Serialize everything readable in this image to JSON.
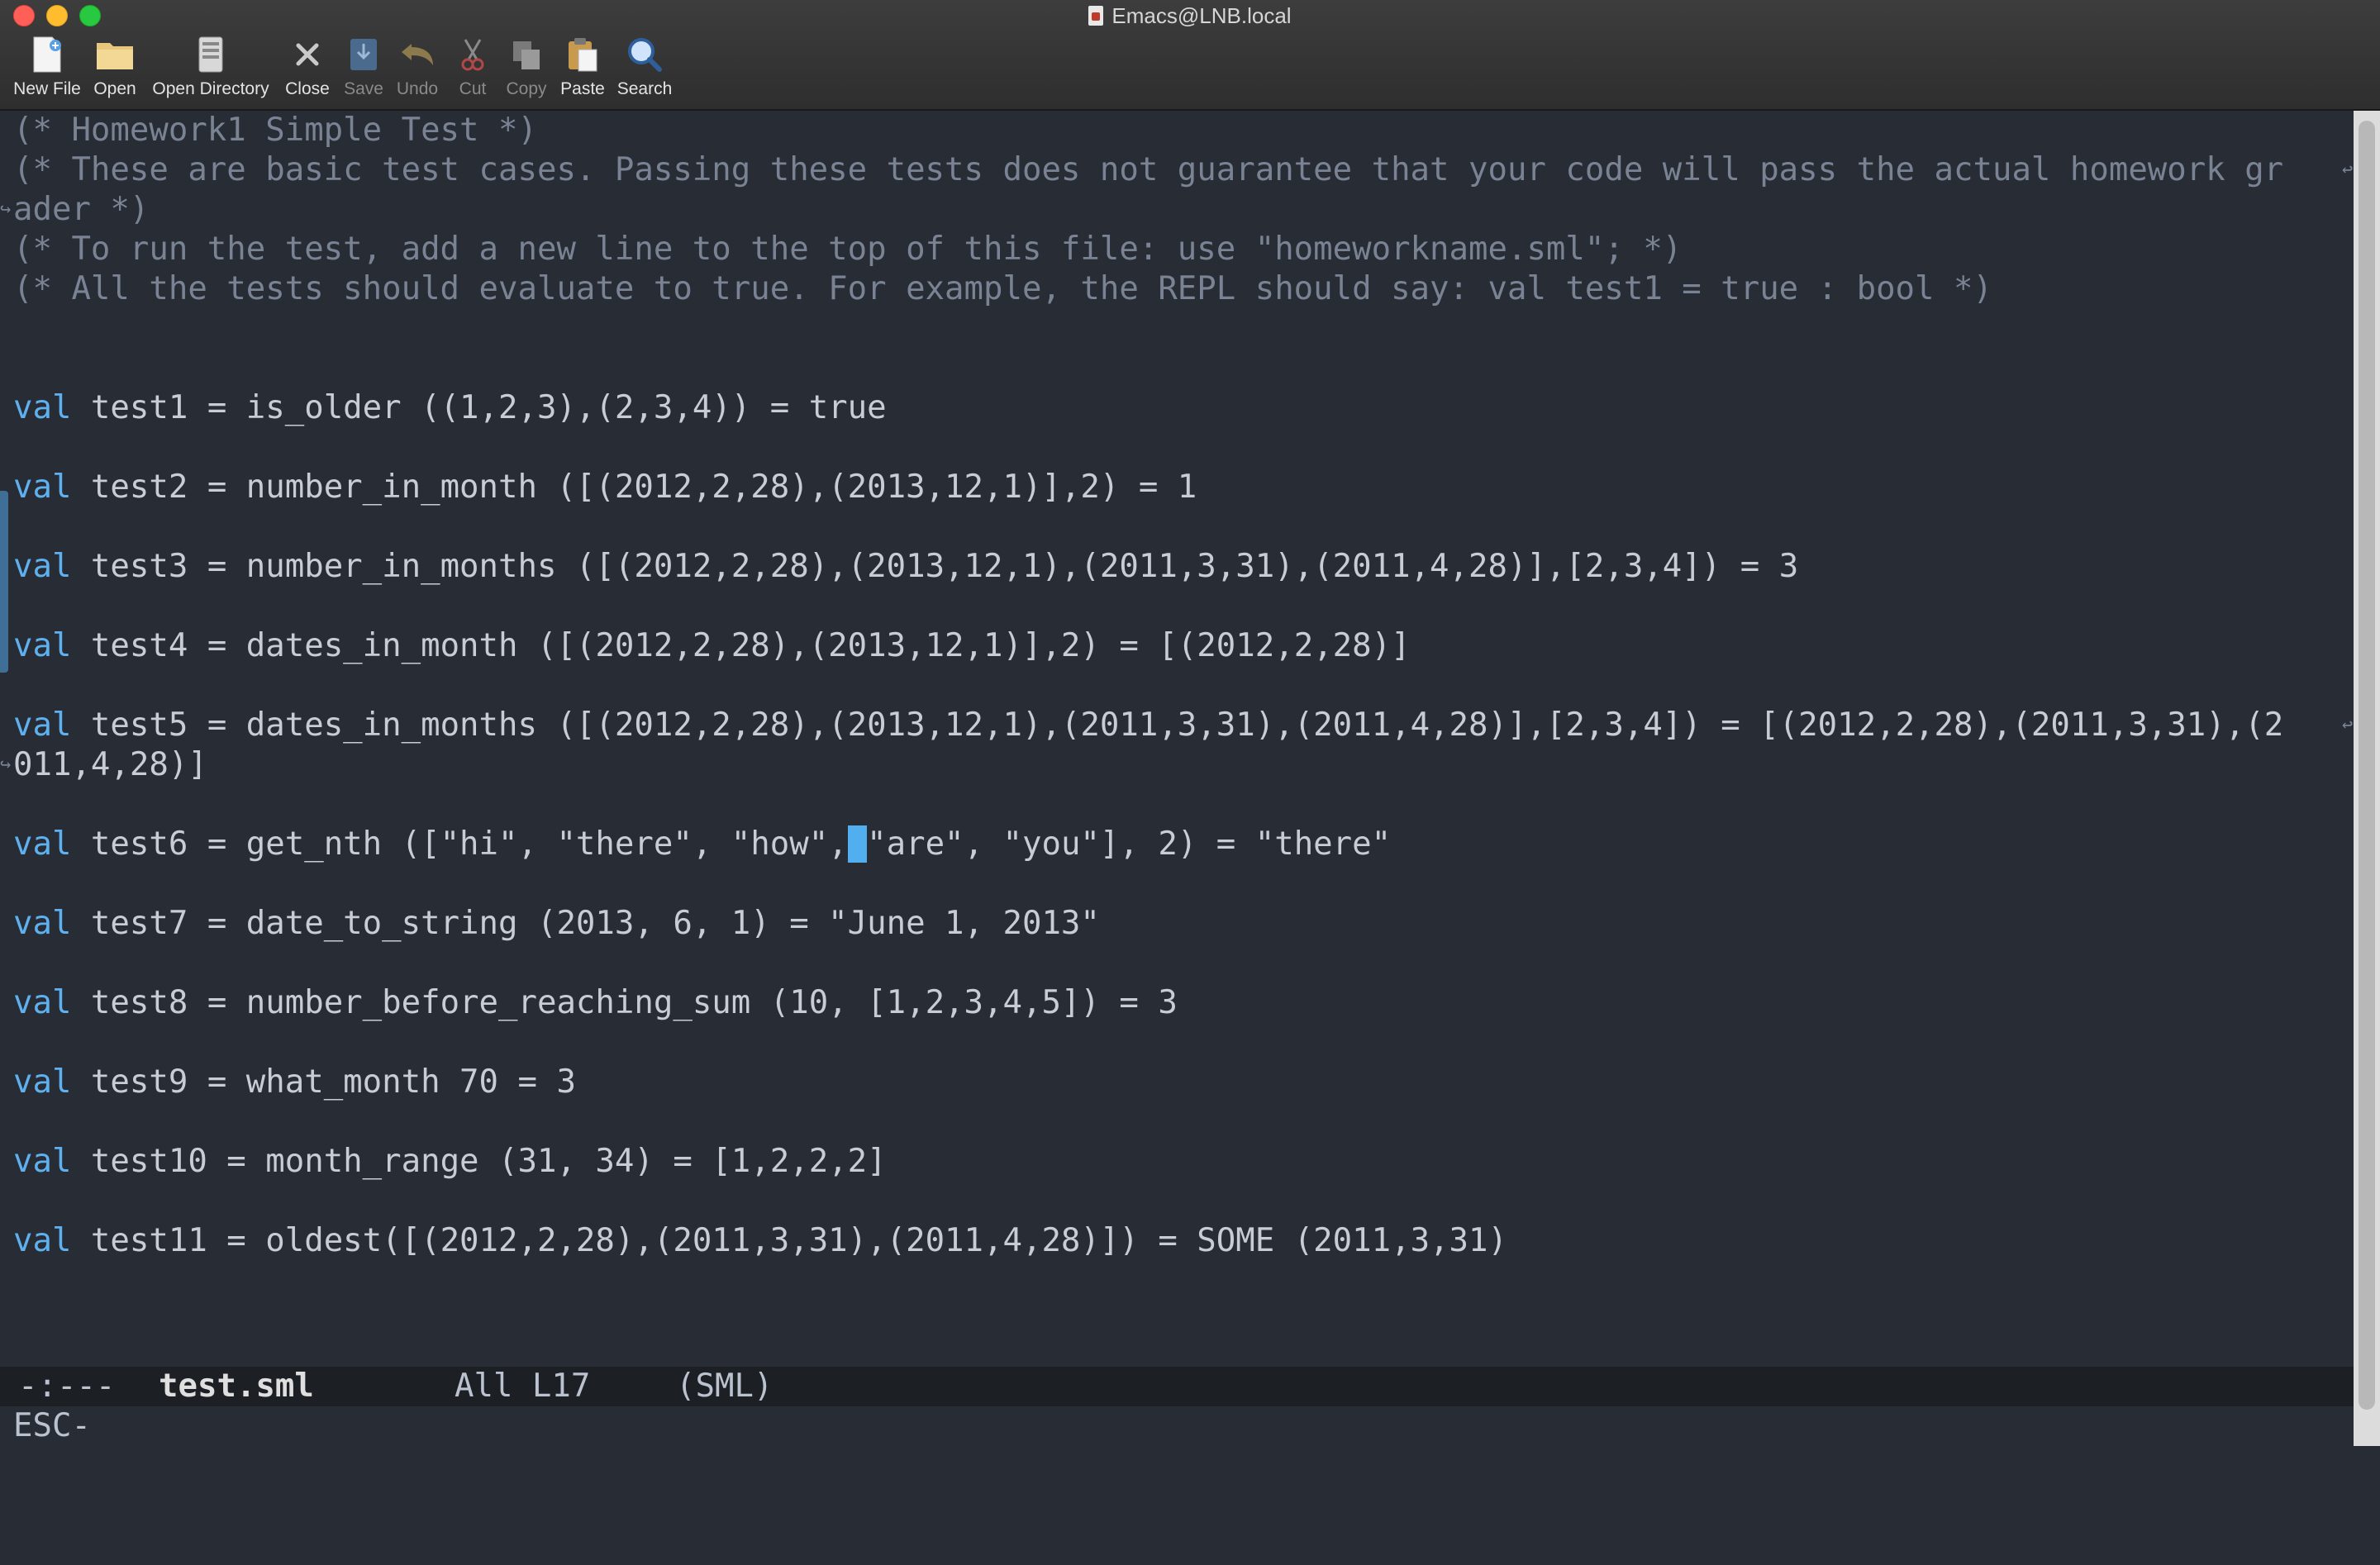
{
  "window": {
    "title": "Emacs@LNB.local"
  },
  "toolbar": [
    {
      "id": "new-file",
      "label": "New File",
      "icon": "new-file-icon",
      "enabled": true
    },
    {
      "id": "open",
      "label": "Open",
      "icon": "folder-icon",
      "enabled": true
    },
    {
      "id": "open-directory",
      "label": "Open Directory",
      "icon": "directory-icon",
      "enabled": true
    },
    {
      "id": "close",
      "label": "Close",
      "icon": "close-x-icon",
      "enabled": true
    },
    {
      "id": "save",
      "label": "Save",
      "icon": "save-icon",
      "enabled": false
    },
    {
      "id": "undo",
      "label": "Undo",
      "icon": "undo-icon",
      "enabled": false
    },
    {
      "id": "cut",
      "label": "Cut",
      "icon": "scissors-icon",
      "enabled": false
    },
    {
      "id": "copy",
      "label": "Copy",
      "icon": "copy-icon",
      "enabled": false
    },
    {
      "id": "paste",
      "label": "Paste",
      "icon": "paste-icon",
      "enabled": true
    },
    {
      "id": "search",
      "label": "Search",
      "icon": "magnifier-icon",
      "enabled": true
    }
  ],
  "editor": {
    "comments": [
      "(* Homework1 Simple Test *)",
      "(* These are basic test cases. Passing these tests does not guarantee that your code will pass the actual homework gr",
      "ader *)",
      "(* To run the test, add a new line to the top of this file: use \"homeworkname.sml\"; *)",
      "(* All the tests should evaluate to true. For example, the REPL should say: val test1 = true : bool *)"
    ],
    "keyword": "val",
    "tests": [
      " test1 = is_older ((1,2,3),(2,3,4)) = true",
      " test2 = number_in_month ([(2012,2,28),(2013,12,1)],2) = 1",
      " test3 = number_in_months ([(2012,2,28),(2013,12,1),(2011,3,31),(2011,4,28)],[2,3,4]) = 3",
      " test4 = dates_in_month ([(2012,2,28),(2013,12,1)],2) = [(2012,2,28)]",
      " test5 = dates_in_months ([(2012,2,28),(2013,12,1),(2011,3,31),(2011,4,28)],[2,3,4]) = [(2012,2,28),(2011,3,31),(2",
      " test6 = get_nth ([\"hi\", \"there\", \"how\",",
      " test7 = date_to_string (2013, 6, 1) = \"June 1, 2013\"",
      " test8 = number_before_reaching_sum (10, [1,2,3,4,5]) = 3",
      " test9 = what_month 70 = 3",
      " test10 = month_range (31, 34) = [1,2,2,2]",
      " test11 = oldest([(2012,2,28),(2011,3,31),(2011,4,28)]) = SOME (2011,3,31)"
    ],
    "test5_continuation": "011,4,28)]",
    "test6_cursor_char": " ",
    "test6_rest": "\"are\", \"you\"], 2) = \"there\""
  },
  "modeline": {
    "status": "-:---",
    "buffer": "test.sml",
    "position": "All L17",
    "mode": "(SML)"
  },
  "minibuffer": {
    "text": "ESC-"
  },
  "colors": {
    "background": "#282c34",
    "comment": "#7a8394",
    "keyword": "#5fb0ee",
    "text": "#bbc2cf",
    "cursor": "#51afef"
  }
}
